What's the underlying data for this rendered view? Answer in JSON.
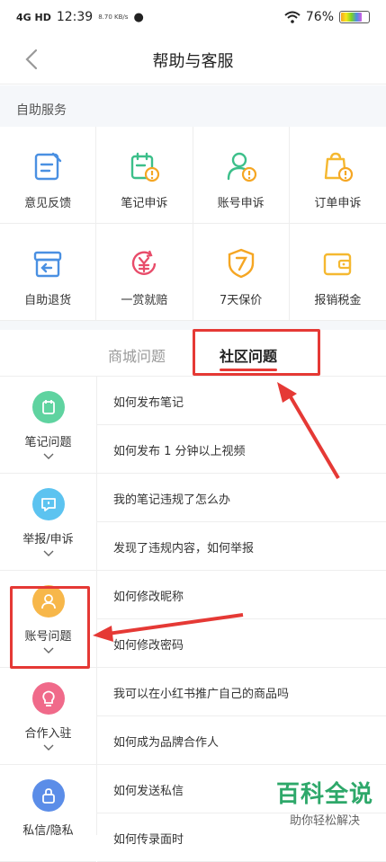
{
  "status": {
    "time": "12:39",
    "signal": "4G HD",
    "speed": "8.70 KB/s",
    "battery": "76%"
  },
  "header": {
    "title": "帮助与客服"
  },
  "self_service": {
    "label": "自助服务",
    "items": [
      {
        "label": "意见反馈",
        "icon": "feedback-icon",
        "color": "#4a90e2"
      },
      {
        "label": "笔记申诉",
        "icon": "note-appeal-icon",
        "color": "#3cbf8a"
      },
      {
        "label": "账号申诉",
        "icon": "account-appeal-icon",
        "color": "#3cbf8a"
      },
      {
        "label": "订单申诉",
        "icon": "order-appeal-icon",
        "color": "#f5b830"
      },
      {
        "label": "自助退货",
        "icon": "return-icon",
        "color": "#4a90e2"
      },
      {
        "label": "一赏就赔",
        "icon": "compensation-icon",
        "color": "#e84c6a"
      },
      {
        "label": "7天保价",
        "icon": "price-protect-icon",
        "color": "#f5a623"
      },
      {
        "label": "报销税金",
        "icon": "wallet-icon",
        "color": "#f5b830"
      }
    ]
  },
  "tabs": [
    {
      "label": "商城问题"
    },
    {
      "label": "社区问题"
    }
  ],
  "categories": [
    {
      "label": "笔记问题",
      "icon": "note-icon",
      "color": "#5fd3a0"
    },
    {
      "label": "举报/申诉",
      "icon": "report-icon",
      "color": "#5cc3f0"
    },
    {
      "label": "账号问题",
      "icon": "user-icon",
      "color": "#f7b74a"
    },
    {
      "label": "合作入驻",
      "icon": "bulb-icon",
      "color": "#f06a8a"
    },
    {
      "label": "私信/隐私",
      "icon": "lock-icon",
      "color": "#5b8de8"
    }
  ],
  "questions": [
    "如何发布笔记",
    "如何发布 1 分钟以上视频",
    "我的笔记违规了怎么办",
    "发现了违规内容，如何举报",
    "如何修改昵称",
    "如何修改密码",
    "我可以在小红书推广自己的商品吗",
    "如何成为品牌合作人",
    "如何发送私信",
    "如何传录面时"
  ],
  "watermark": {
    "big": "百科全说",
    "small": "助你轻松解决"
  }
}
